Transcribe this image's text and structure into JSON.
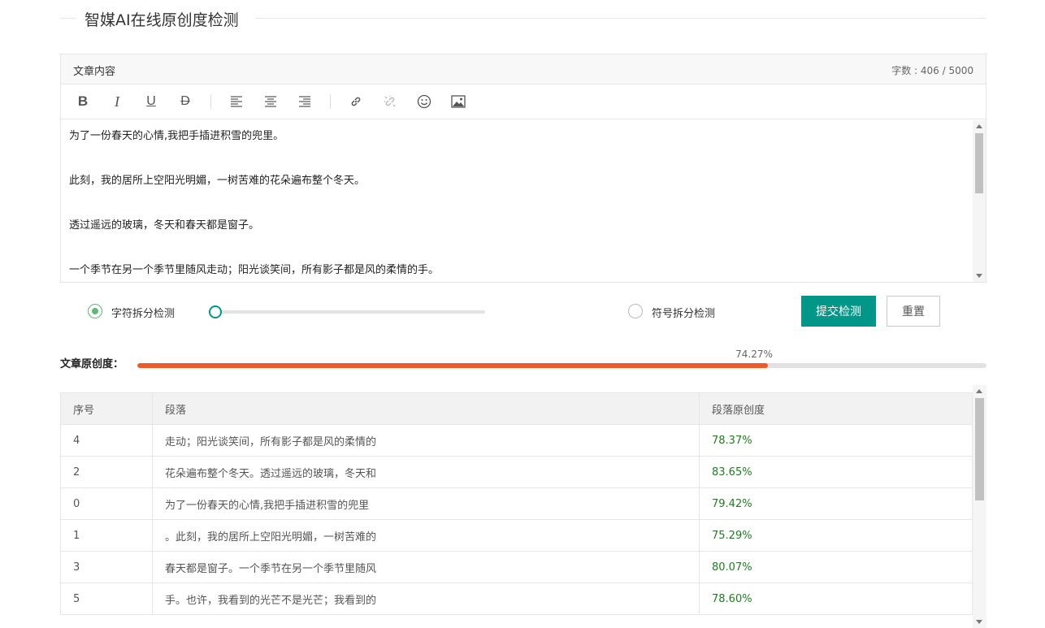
{
  "page": {
    "title": "智媒AI在线原创度检测"
  },
  "editor": {
    "label": "文章内容",
    "count_label": "字数 : 406 / 5000",
    "paragraphs": [
      "为了一份春天的心情,我把手插进积雪的兜里。",
      "此刻，我的居所上空阳光明媚，一树苦难的花朵遍布整个冬天。",
      "透过遥远的玻璃，冬天和春天都是窗子。",
      "一个季节在另一个季节里随风走动；阳光谈笑间，所有影子都是风的柔情的手。"
    ]
  },
  "toolbar": {
    "bold": "B",
    "italic": "I",
    "underline": "U",
    "strike": "D"
  },
  "options": {
    "char_split_label": "字符拆分检测",
    "char_split_selected": true,
    "slider_value": 0,
    "symbol_split_label": "符号拆分检测",
    "symbol_split_selected": false,
    "submit_label": "提交检测",
    "reset_label": "重置"
  },
  "originality": {
    "label": "文章原创度：",
    "percent_text": "74.27%",
    "percent": 74.27,
    "bar_color": "#f05a28"
  },
  "table": {
    "headers": [
      "序号",
      "段落",
      "段落原创度"
    ],
    "rows": [
      [
        "4",
        "走动；阳光谈笑间，所有影子都是风的柔情的",
        "78.37%"
      ],
      [
        "2",
        "花朵遍布整个冬天。透过遥远的玻璃，冬天和",
        "83.65%"
      ],
      [
        "0",
        "为了一份春天的心情,我把手插进积雪的兜里",
        "79.42%"
      ],
      [
        "1",
        "。此刻，我的居所上空阳光明媚，一树苦难的",
        "75.29%"
      ],
      [
        "3",
        "春天都是窗子。一个季节在另一个季节里随风",
        "80.07%"
      ],
      [
        "5",
        "手。也许，我看到的光芒不是光芒；我看到的",
        "78.60%"
      ]
    ]
  },
  "colors": {
    "primary": "#009688",
    "radio": "#5fb878",
    "percent_text": "#1e7e1e"
  }
}
